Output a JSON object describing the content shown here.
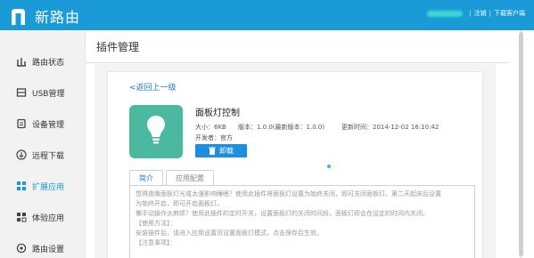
{
  "header": {
    "brand": "新路由",
    "username": "",
    "sep1": "|",
    "logout": "注销",
    "sep2": "|",
    "download_client": "下载客户端",
    "bg_color": "#1a9bd7"
  },
  "sidebar": {
    "items": [
      {
        "label": "路由状态",
        "icon": "router-status-icon"
      },
      {
        "label": "USB管理",
        "icon": "usb-icon"
      },
      {
        "label": "设备管理",
        "icon": "device-icon"
      },
      {
        "label": "远程下载",
        "icon": "download-icon"
      },
      {
        "label": "扩展应用",
        "icon": "apps-icon",
        "active": true
      },
      {
        "label": "体验应用",
        "icon": "experience-icon"
      },
      {
        "label": "路由设置",
        "icon": "settings-icon"
      }
    ],
    "active_color": "#1a9bd7"
  },
  "main": {
    "title": "插件管理",
    "back": "<返回上一级",
    "plugin": {
      "name": "面板灯控制",
      "size": "大小：6KB",
      "version": "版本：1.0.0(最新版本：1.0.0)",
      "updated": "更新时间：2014-12-02 16:10:42",
      "developer": "开发者：官方",
      "uninstall": "卸载",
      "icon": "lightbulb-icon",
      "icon_color": "#4bb8a0"
    },
    "tabs": [
      "简介",
      "应用配置"
    ],
    "description": [
      "觉得夜晚面板灯光或太强影响睡眠？使用此插件将面板灯设置为始终关闭，即可关闭面板灯。第二天起床后设置",
      "为始终开启，即可开启面板灯。",
      "懒手动操作太麻烦？使用此插件的定时开关，设置面板灯的关闭时间段，面板灯即会在设定的时间内关闭。",
      "【使用方法】：",
      "安装插件后，请进入应用设置页设置面板灯模式，点击保存后生效。",
      "【注意事项】："
    ]
  }
}
